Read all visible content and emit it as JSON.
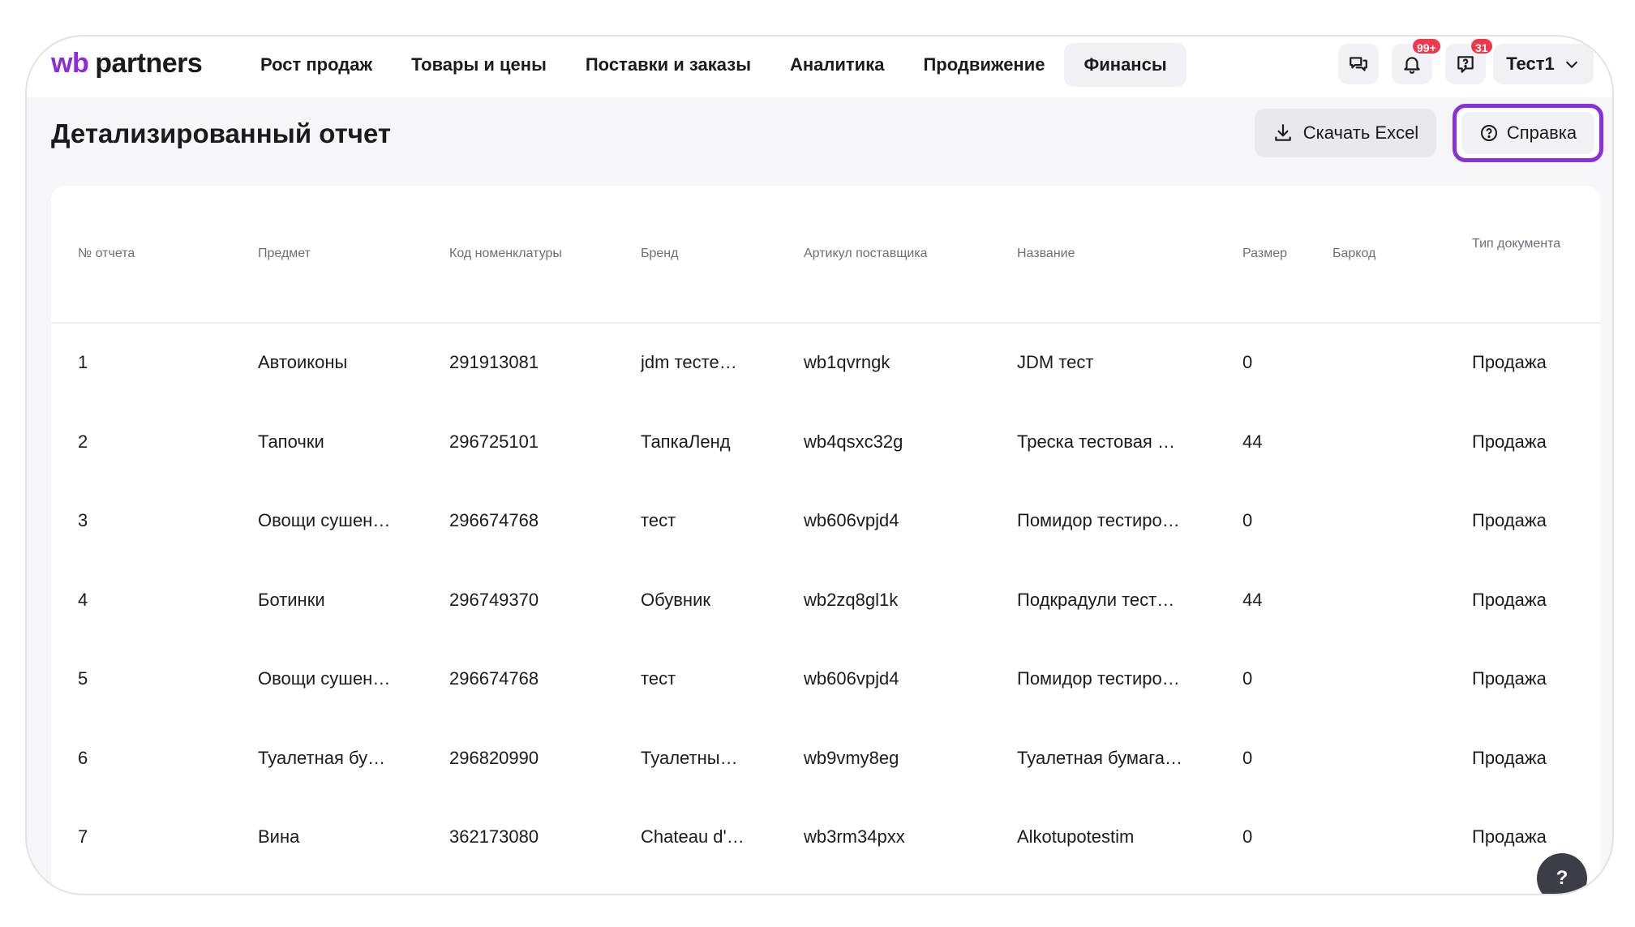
{
  "header": {
    "logo_wb": "wb",
    "logo_partners": "partners",
    "nav": [
      {
        "label": "Рост продаж",
        "active": false
      },
      {
        "label": "Товары и цены",
        "active": false
      },
      {
        "label": "Поставки и заказы",
        "active": false
      },
      {
        "label": "Аналитика",
        "active": false
      },
      {
        "label": "Продвижение",
        "active": false
      },
      {
        "label": "Финансы",
        "active": true
      }
    ],
    "notifications_badge": "99+",
    "support_badge": "31",
    "user_name": "Тест1"
  },
  "page": {
    "title": "Детализированный отчет",
    "download_label": "Скачать Excel",
    "help_label": "Справка",
    "fab_label": "?"
  },
  "table": {
    "columns": [
      "№ отчета",
      "Предмет",
      "Код номенклатуры",
      "Бренд",
      "Артикул поставщика",
      "Название",
      "Размер",
      "Баркод",
      "Тип документа"
    ],
    "rows": [
      [
        "1",
        "Автоиконы",
        "291913081",
        "jdm тесте…",
        "wb1qvrngk",
        "JDM тест",
        "0",
        "",
        "Продажа"
      ],
      [
        "2",
        "Тапочки",
        "296725101",
        "ТапкаЛенд",
        "wb4qsxc32g",
        "Треска тестовая …",
        "44",
        "",
        "Продажа"
      ],
      [
        "3",
        "Овощи сушен…",
        "296674768",
        "тест",
        "wb606vpjd4",
        "Помидор тестиро…",
        "0",
        "",
        "Продажа"
      ],
      [
        "4",
        "Ботинки",
        "296749370",
        "Обувник",
        "wb2zq8gl1k",
        "Подкрадули тест…",
        "44",
        "",
        "Продажа"
      ],
      [
        "5",
        "Овощи сушен…",
        "296674768",
        "тест",
        "wb606vpjd4",
        "Помидор тестиро…",
        "0",
        "",
        "Продажа"
      ],
      [
        "6",
        "Туалетная бу…",
        "296820990",
        "Туалетны…",
        "wb9vmy8eg",
        "Туалетная бумага…",
        "0",
        "",
        "Продажа"
      ],
      [
        "7",
        "Вина",
        "362173080",
        "Chateau d'…",
        "wb3rm34pxx",
        "Alkotupotestim",
        "0",
        "",
        "Продажа"
      ]
    ]
  },
  "colors": {
    "accent": "#8b2fdc",
    "badge": "#f0374c"
  }
}
